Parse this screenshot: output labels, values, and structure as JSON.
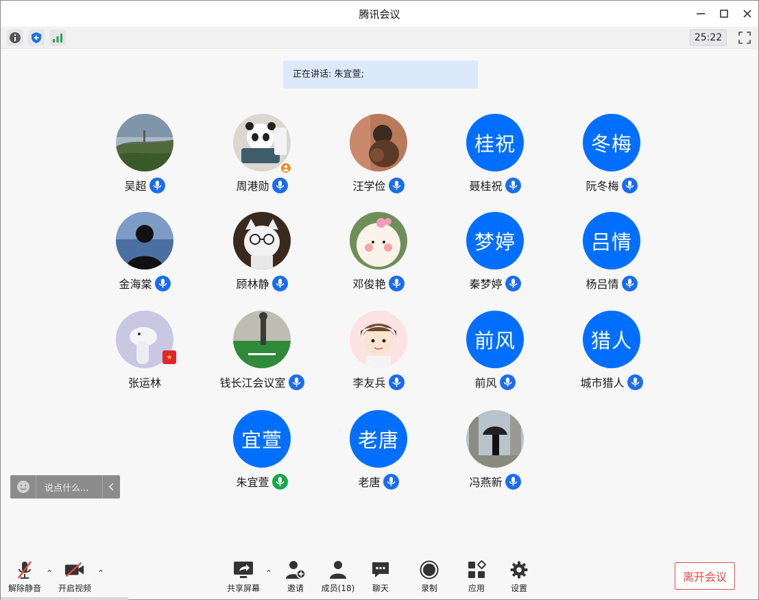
{
  "window": {
    "title": "腾讯会议",
    "minimize_icon": "minimize-icon",
    "maximize_icon": "maximize-icon",
    "close_icon": "close-icon"
  },
  "infobar": {
    "icons": [
      "info-icon",
      "shield-icon",
      "signal-icon"
    ],
    "timer": "25:22",
    "fullscreen_icon": "fullscreen-icon"
  },
  "speaking": {
    "text": "正在讲话: 朱宜萱;"
  },
  "participants": [
    {
      "name": "吴超",
      "avatar_text": "",
      "avatar": "landscape-photo",
      "mic": "blue"
    },
    {
      "name": "周港勋",
      "avatar_text": "",
      "avatar": "panda-photo",
      "mic": "blue",
      "host": true
    },
    {
      "name": "汪学俭",
      "avatar_text": "",
      "avatar": "dog-photo",
      "mic": "blue"
    },
    {
      "name": "聂桂祝",
      "avatar_text": "桂祝",
      "mic": "blue"
    },
    {
      "name": "阮冬梅",
      "avatar_text": "冬梅",
      "mic": "blue"
    },
    {
      "name": "金海棠",
      "avatar_text": "",
      "avatar": "silhouette-photo",
      "mic": "blue"
    },
    {
      "name": "顾林静",
      "avatar_text": "",
      "avatar": "cat-photo",
      "mic": "blue"
    },
    {
      "name": "邓俊艳",
      "avatar_text": "",
      "avatar": "cartoon-face",
      "mic": "blue"
    },
    {
      "name": "秦梦婷",
      "avatar_text": "梦婷",
      "mic": "blue"
    },
    {
      "name": "杨吕情",
      "avatar_text": "吕情",
      "mic": "blue"
    },
    {
      "name": "张运林",
      "avatar_text": "",
      "avatar": "toy-photo",
      "mic": "none",
      "flag": true
    },
    {
      "name": "钱长江会议室",
      "avatar_text": "",
      "avatar": "golf-photo",
      "mic": "blue"
    },
    {
      "name": "李友兵",
      "avatar_text": "",
      "avatar": "cartoon-boy",
      "mic": "blue"
    },
    {
      "name": "前风",
      "avatar_text": "前风",
      "mic": "blue"
    },
    {
      "name": "城市猎人",
      "avatar_text": "猎人",
      "mic": "blue"
    },
    {
      "name": "朱宜萱",
      "avatar_text": "宜萱",
      "mic": "green"
    },
    {
      "name": "老唐",
      "avatar_text": "老唐",
      "mic": "blue"
    },
    {
      "name": "冯燕新",
      "avatar_text": "",
      "avatar": "umbrella-photo",
      "mic": "blue"
    }
  ],
  "chat": {
    "placeholder": "说点什么...",
    "emoji_icon": "emoji-icon",
    "collapse_icon": "chevron-left-icon"
  },
  "toolbar": {
    "unmute": "解除静音",
    "start_video": "开启视频",
    "share_screen": "共享屏幕",
    "invite": "邀请",
    "members": "成员(18)",
    "chat": "聊天",
    "record": "录制",
    "apps": "应用",
    "settings": "设置",
    "leave": "离开会议"
  },
  "colors": {
    "accent": "#006fff",
    "speaking_bg": "#dce9fb",
    "leave": "#e5473e",
    "mic_active": "#1aa54a"
  }
}
